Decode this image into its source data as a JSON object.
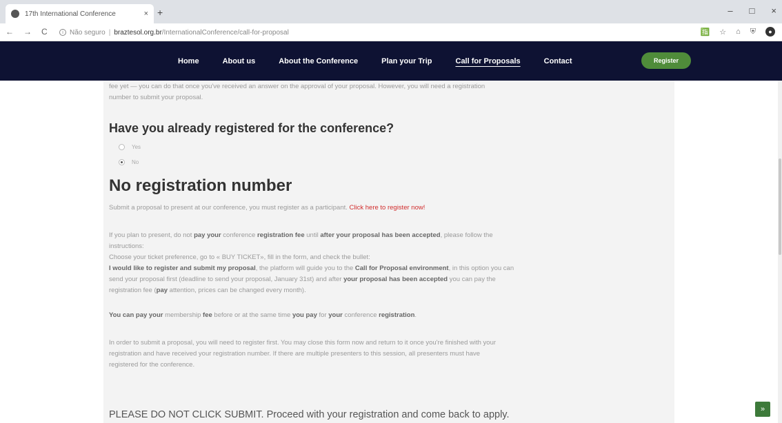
{
  "browser": {
    "tab_title": "17th International Conference",
    "tab_close": "×",
    "new_tab": "+",
    "window_controls": [
      "–",
      "□",
      "×"
    ],
    "nav_buttons": [
      "←",
      "→",
      "C"
    ],
    "address": {
      "security": "Não seguro",
      "host": "braztesol.org.br",
      "path": "/InternationalConference/call-for-proposal"
    }
  },
  "site_nav": {
    "items": [
      "Home",
      "About us",
      "About the Conference",
      "Plan your Trip",
      "Call for Proposals",
      "Contact"
    ],
    "register_label": "Register"
  },
  "content": {
    "intro_line1": "fee yet — you can do that once you've received an answer on the approval of your proposal. However, you will need a registration",
    "intro_line2": "number to submit your proposal.",
    "question_heading": "Have you already registered for the conference?",
    "radio_options": [
      {
        "label": "Yes",
        "checked": false
      },
      {
        "label": "No",
        "checked": true
      }
    ],
    "section_heading": "No registration number",
    "submit_text": "Submit a proposal to present at our conference, you must register as a participant.",
    "register_link": "Click here to register now!",
    "p1_a": "If you plan to present, do not ",
    "p1_b": "pay your",
    "p1_c": " conference ",
    "p1_d": "registration fee",
    "p1_e": " until ",
    "p1_f": "after your proposal has been accepted",
    "p1_g": ", please follow the",
    "p1_line2": "instructions:",
    "p2": "Choose your ticket preference, go to « BUY TICKET», fill in the form, and check the bullet:",
    "p3_a": "I would like to register and submit my proposal",
    "p3_b": ", the platform will guide you to the ",
    "p3_c": "Call for Proposal environment",
    "p3_d": ", in this option you can",
    "p3_line2_a": "send your proposal first (deadline to send your proposal, January 31st) and after ",
    "p3_line2_b": "your proposal has been accepted",
    "p3_line2_c": " you can pay the",
    "p3_line3_a": "registration fee (",
    "p3_line3_b": "pay",
    "p3_line3_c": " attention, prices can be changed every month).",
    "p4_a": "You can pay your",
    "p4_b": " membership ",
    "p4_c": "fee",
    "p4_d": " before or at the same time ",
    "p4_e": "you pay",
    "p4_f": " for ",
    "p4_g": "your",
    "p4_h": " conference ",
    "p4_i": "registration",
    "p4_j": ".",
    "p5_line1": "In order to submit a proposal, you will need to register first. You may close this form now and return to it once you're finished with your",
    "p5_line2": "registration and have received your registration number. If there are multiple presenters to this session, all presenters must have",
    "p5_line3": "registered for the conference.",
    "notice": "PLEASE DO NOT CLICK SUBMIT. Proceed with your registration and come back to apply."
  },
  "back_to_top": "»"
}
